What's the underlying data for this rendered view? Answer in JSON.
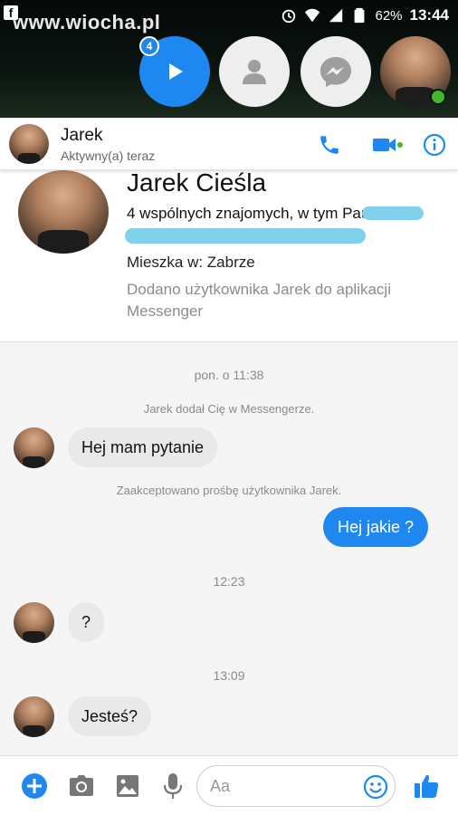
{
  "status_bar": {
    "watermark": "www.wiocha.pl",
    "battery_percent": "62%",
    "time": "13:44"
  },
  "chat_heads": {
    "badge_count": "4"
  },
  "header": {
    "name": "Jarek",
    "status": "Aktywny(a) teraz"
  },
  "profile": {
    "full_name": "Jarek Cieśla",
    "mutual_friends": "4 wspólnych znajomych, w tym Paulina",
    "lives_in": "Mieszka w: Zabrze",
    "added_text": "Dodano użytkownika Jarek do aplikacji Messenger"
  },
  "conversation": {
    "timestamp_1": "pon. o 11:38",
    "system_1": "Jarek dodał Cię w Messengerze.",
    "msg_1": "Hej mam pytanie",
    "system_2": "Zaakceptowano prośbę użytkownika Jarek.",
    "msg_2": "Hej jakie ?",
    "timestamp_2": "12:23",
    "msg_3": "?",
    "timestamp_3": "13:09",
    "msg_4": "Jesteś?"
  },
  "composer": {
    "placeholder": "Aa"
  },
  "colors": {
    "messenger_blue": "#1e88f0",
    "online_green": "#42b72a",
    "scribble": "#7fd1ee"
  },
  "icons": [
    "facebook-icon",
    "alarm-icon",
    "wifi-icon",
    "signal-icon",
    "battery-icon",
    "play-icon",
    "contacts-icon",
    "messenger-icon",
    "phone-icon",
    "video-icon",
    "info-icon",
    "plus-icon",
    "camera-icon",
    "image-icon",
    "microphone-icon",
    "emoji-icon",
    "like-icon"
  ]
}
